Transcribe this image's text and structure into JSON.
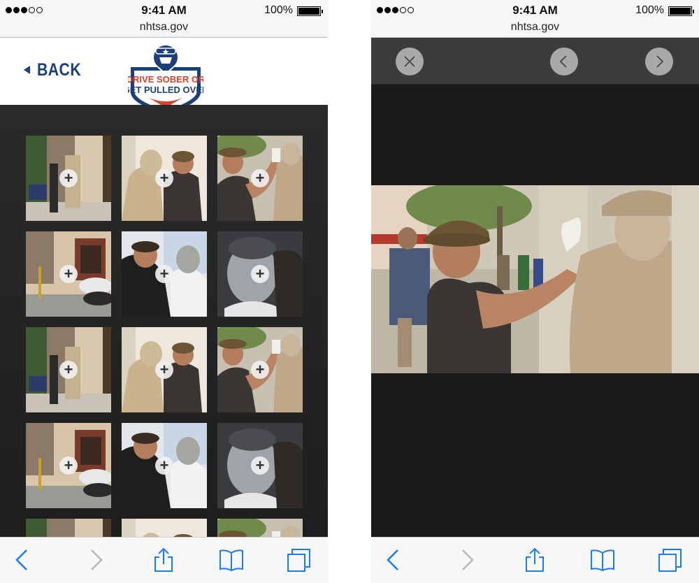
{
  "status": {
    "carrier_dots": 5,
    "carrier_filled": 3,
    "time": "9:41 AM",
    "battery_percent": "100%",
    "battery_level": 1.0
  },
  "browser": {
    "url": "nhtsa.gov"
  },
  "left_screen": {
    "back_label": "BACK",
    "logo": {
      "line1": "DRIVE SOBER OR",
      "line2": "GET PULLED OVER"
    },
    "gallery": {
      "plus_glyph": "+",
      "thumbnails": [
        {
          "subject": "statue-street-wide"
        },
        {
          "subject": "statue-closeup-painter"
        },
        {
          "subject": "painter-raising-fist"
        },
        {
          "subject": "storefront-street-cars"
        },
        {
          "subject": "painting-face"
        },
        {
          "subject": "painted-face-closeup"
        },
        {
          "subject": "statue-street-wide"
        },
        {
          "subject": "statue-closeup-painter"
        },
        {
          "subject": "painter-raising-fist"
        },
        {
          "subject": "storefront-street-cars"
        },
        {
          "subject": "painting-face"
        },
        {
          "subject": "painted-face-closeup"
        },
        {
          "subject": "statue-street-wide"
        },
        {
          "subject": "statue-closeup-painter"
        },
        {
          "subject": "painter-raising-fist"
        }
      ]
    }
  },
  "right_screen": {
    "viewer_controls": [
      "close-icon",
      "chevron-left-icon",
      "chevron-right-icon"
    ],
    "photo_subject": "painter-raising-fist"
  },
  "toolbar_icons": [
    "back-arrow-icon",
    "forward-arrow-icon",
    "share-icon",
    "bookmarks-icon",
    "tabs-icon"
  ],
  "colors": {
    "brand_blue": "#1c3f7a",
    "brand_red": "#d9412b",
    "toolbar_blue": "#1a7cf3",
    "gallery_bg": "#262626"
  }
}
